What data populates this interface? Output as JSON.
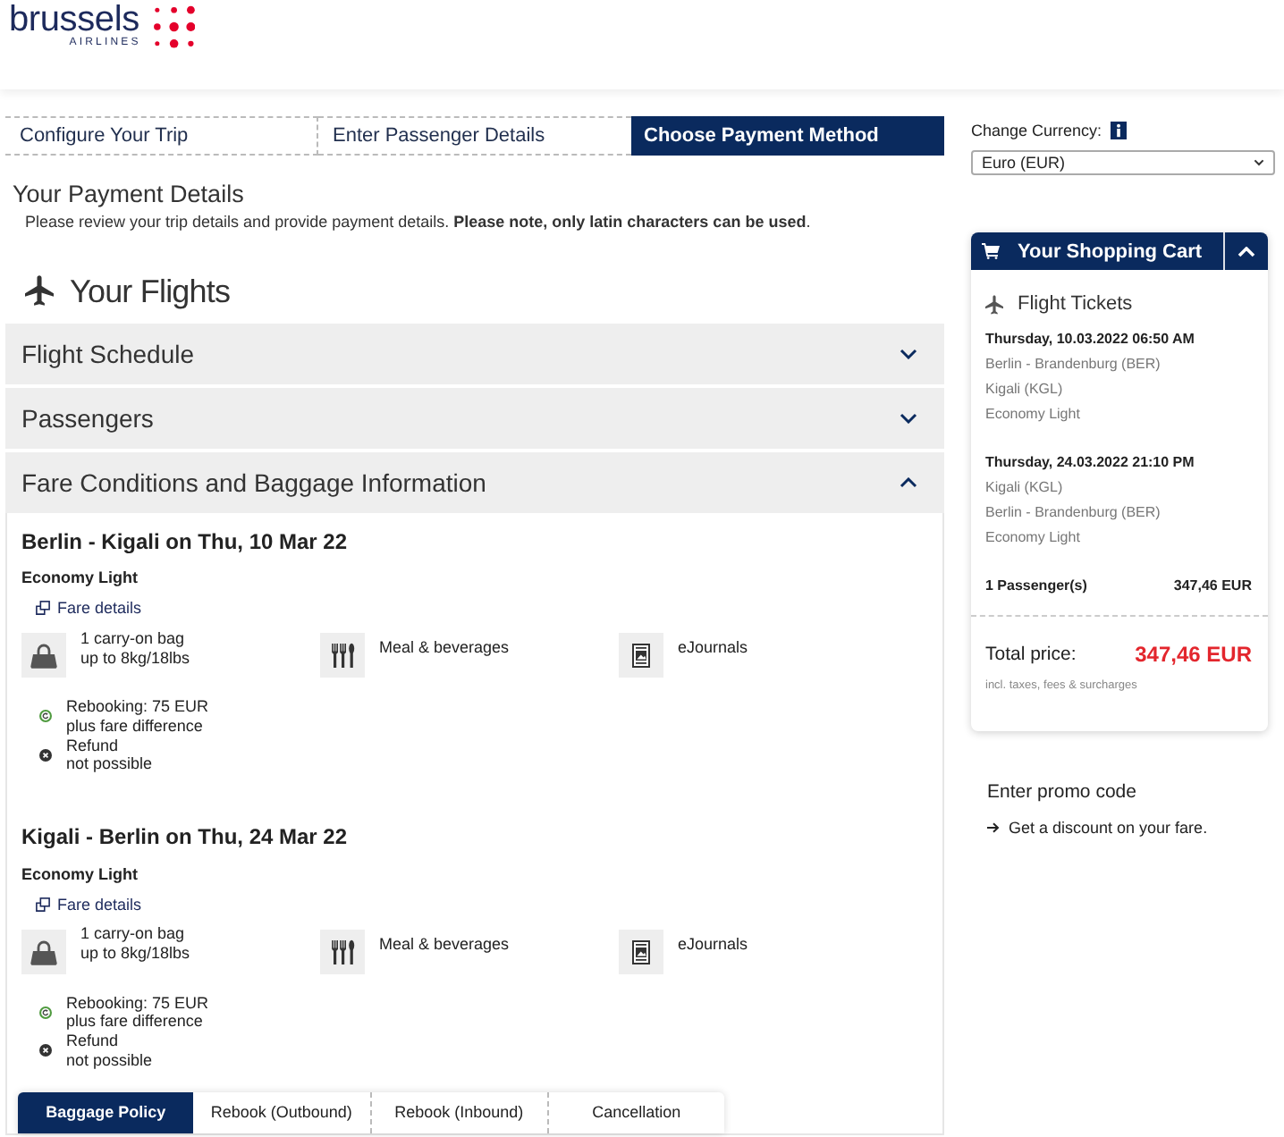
{
  "header": {
    "logo": {
      "wordmark": "brussels",
      "tagline": "AIRLINES"
    }
  },
  "steps": [
    {
      "label": "Configure Your Trip",
      "selected": false
    },
    {
      "label": "Enter Passenger Details",
      "selected": false
    },
    {
      "label": "Choose Payment Method",
      "selected": true
    }
  ],
  "payment_details": {
    "title": "Your Payment Details",
    "intro": "Please review your trip details and provide payment details. **Please note, only latin characters can be used**."
  },
  "flights": {
    "title": "Your Flights",
    "sections": [
      {
        "label": "Flight Schedule",
        "expanded": false
      },
      {
        "label": "Passengers",
        "expanded": false
      },
      {
        "label": "Fare Conditions and Baggage Information",
        "expanded": true,
        "legs": [
          {
            "route": "Berlin - Kigali on Thu, 10 Mar 22",
            "fare": "Economy Light",
            "fare_details_link": "Fare details",
            "features": [
              {
                "kind": "bag",
                "lines": [
                  "1 carry-on bag",
                  "up to 8kg/18lbs"
                ]
              },
              {
                "kind": "meal",
                "lines": [
                  "Meal & beverages"
                ]
              },
              {
                "kind": "journal",
                "lines": [
                  "eJournals"
                ]
              }
            ],
            "conditions": [
              {
                "kind": "allowed",
                "lines": [
                  "Rebooking: 75 EUR",
                  "plus fare difference"
                ]
              },
              {
                "kind": "not_allowed",
                "lines": [
                  "Refund",
                  "not possible"
                ]
              }
            ]
          },
          {
            "route": "Kigali - Berlin on Thu, 24 Mar 22",
            "fare": "Economy Light",
            "fare_details_link": "Fare details",
            "features": [
              {
                "kind": "bag",
                "lines": [
                  "1 carry-on bag",
                  "up to 8kg/18lbs"
                ]
              },
              {
                "kind": "meal",
                "lines": [
                  "Meal & beverages"
                ]
              },
              {
                "kind": "journal",
                "lines": [
                  "eJournals"
                ]
              }
            ],
            "conditions": [
              {
                "kind": "allowed",
                "lines": [
                  "Rebooking: 75 EUR",
                  "plus fare difference"
                ]
              },
              {
                "kind": "not_allowed",
                "lines": [
                  "Refund",
                  "not possible"
                ]
              }
            ]
          }
        ],
        "policy_tabs": [
          {
            "label": "Baggage Policy",
            "selected": true
          },
          {
            "label": "Rebook (Outbound)",
            "selected": false
          },
          {
            "label": "Rebook (Inbound)",
            "selected": false
          },
          {
            "label": "Cancellation",
            "selected": false
          }
        ]
      }
    ]
  },
  "currency": {
    "label": "Change Currency:",
    "value": "Euro (EUR)"
  },
  "cart": {
    "title": "Your Shopping Cart",
    "expanded": true,
    "section_title": "Flight Tickets",
    "flights": [
      {
        "departure": "Thursday, 10.03.2022 06:50 AM",
        "from": "Berlin - Brandenburg (BER)",
        "to": "Kigali (KGL)",
        "fare": "Economy Light"
      },
      {
        "departure": "Thursday, 24.03.2022 21:10 PM",
        "from": "Kigali (KGL)",
        "to": "Berlin - Brandenburg (BER)",
        "fare": "Economy Light"
      }
    ],
    "passengers": {
      "label": "1 Passenger(s)",
      "price": "347,46 EUR"
    },
    "total": {
      "label": "Total price:",
      "price": "347,46 EUR",
      "note": "incl. taxes, fees & surcharges"
    }
  },
  "promo": {
    "title": "Enter promo code",
    "link": "Get a discount on your fare."
  }
}
